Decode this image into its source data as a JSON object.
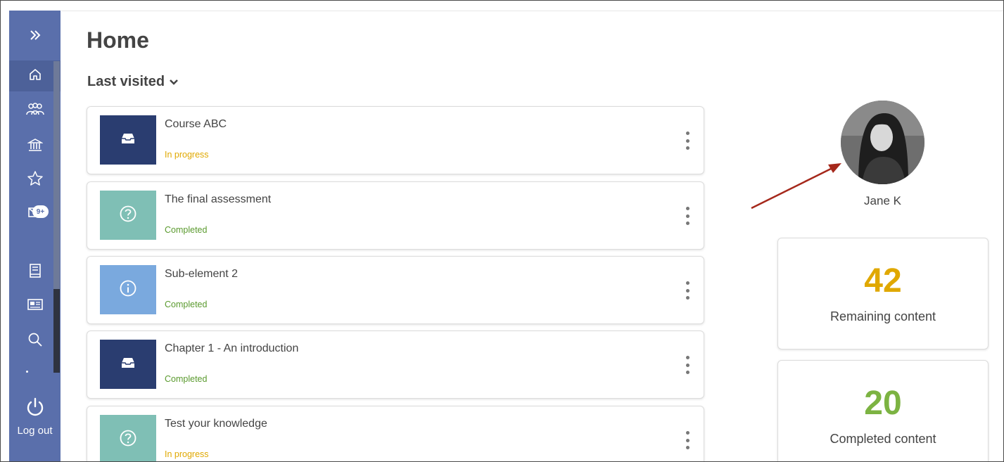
{
  "sidebar": {
    "expand_icon": "double-chevron-right-icon",
    "items": [
      {
        "name": "home",
        "icon": "home-icon"
      },
      {
        "name": "groups",
        "icon": "people-icon"
      },
      {
        "name": "institution",
        "icon": "bank-icon"
      },
      {
        "name": "favorites",
        "icon": "star-icon"
      },
      {
        "name": "messages",
        "icon": "mail-icon",
        "badge": "9+"
      },
      {
        "name": "catalog",
        "icon": "book-icon"
      },
      {
        "name": "news",
        "icon": "newspaper-icon"
      },
      {
        "name": "search",
        "icon": "search-icon"
      }
    ],
    "logout_label": "Log out"
  },
  "main": {
    "title": "Home",
    "section_label": "Last visited",
    "cards": [
      {
        "title": "Course ABC",
        "status": "In progress",
        "status_color": "#e0a800",
        "icon": "inbox-icon",
        "thumb_color": "#2a3d70"
      },
      {
        "title": "The final assessment",
        "status": "Completed",
        "status_color": "#5a9a2e",
        "icon": "question-icon",
        "thumb_color": "#7fbfb5"
      },
      {
        "title": "Sub-element 2",
        "status": "Completed",
        "status_color": "#5a9a2e",
        "icon": "info-icon",
        "thumb_color": "#7aa9de"
      },
      {
        "title": "Chapter 1 - An introduction",
        "status": "Completed",
        "status_color": "#5a9a2e",
        "icon": "inbox-icon",
        "thumb_color": "#2a3d70"
      },
      {
        "title": "Test your knowledge",
        "status": "In progress",
        "status_color": "#e0a800",
        "icon": "question-icon",
        "thumb_color": "#7fbfb5"
      }
    ]
  },
  "profile": {
    "name": "Jane K"
  },
  "stats": {
    "remaining": {
      "value": "42",
      "label": "Remaining content",
      "color": "#e0a800"
    },
    "completed": {
      "value": "20",
      "label": "Completed content",
      "color": "#7cb342"
    }
  },
  "colors": {
    "sidebar": "#5a6fab",
    "annotation_arrow": "#a5281b"
  }
}
